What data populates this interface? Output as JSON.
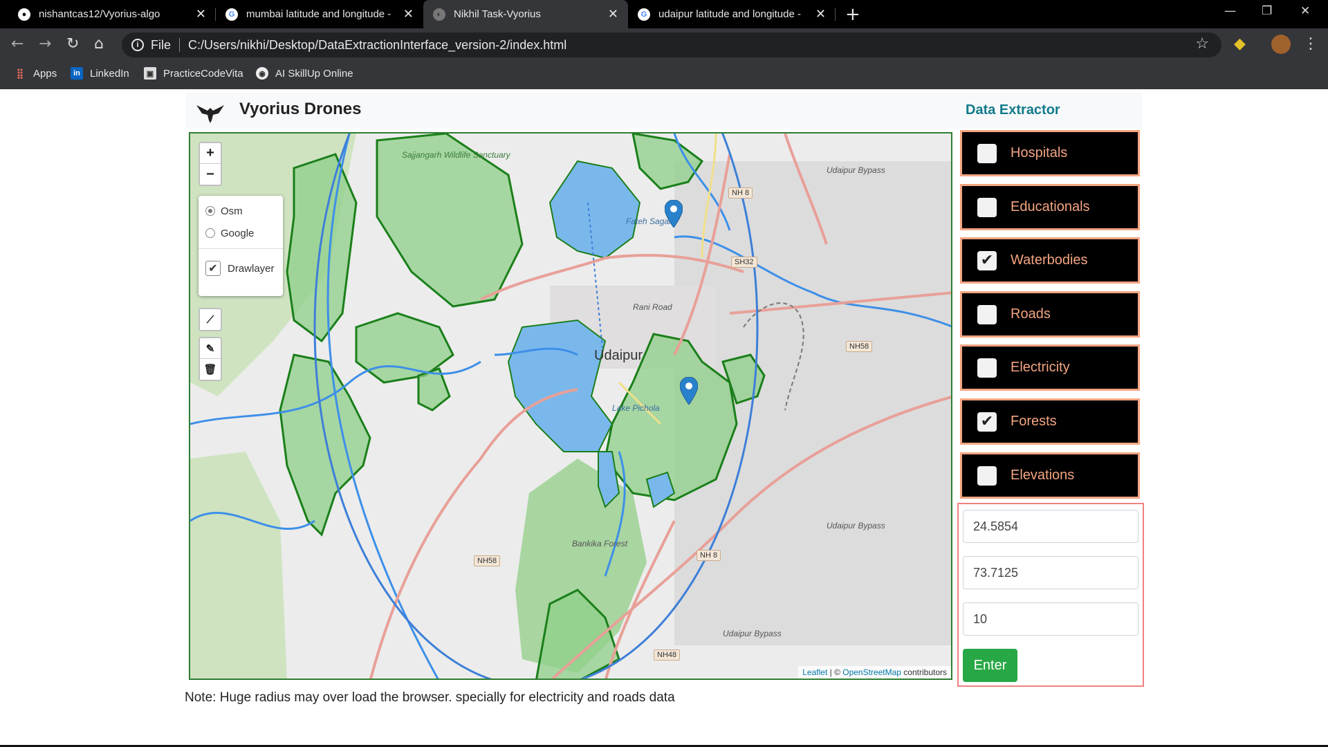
{
  "browser": {
    "tabs": [
      {
        "title": "nishantcas12/Vyorius-algo",
        "icon": "github-icon",
        "active": false
      },
      {
        "title": "mumbai latitude and longitude -",
        "icon": "google-icon",
        "active": false
      },
      {
        "title": "Nikhil Task-Vyorius",
        "icon": "globe-icon",
        "active": true
      },
      {
        "title": "udaipur latitude and longitude -",
        "icon": "google-icon",
        "active": false
      }
    ],
    "scheme_label": "File",
    "url": "C:/Users/nikhi/Desktop/DataExtractionInterface_version-2/index.html",
    "bookmarks": [
      {
        "label": "Apps",
        "icon": "apps-grid-icon"
      },
      {
        "label": "LinkedIn",
        "icon": "linkedin-icon"
      },
      {
        "label": "PracticeCodeVita",
        "icon": "codevita-icon"
      },
      {
        "label": "AI  SkillUp Online",
        "icon": "globe-icon"
      }
    ]
  },
  "header": {
    "brand": "Vyorius Drones",
    "extractor_title": "Data Extractor"
  },
  "map": {
    "zoom_in": "+",
    "zoom_out": "−",
    "layers": {
      "base": [
        {
          "label": "Osm",
          "selected": true
        },
        {
          "label": "Google",
          "selected": false
        }
      ],
      "overlay": {
        "label": "Drawlayer",
        "checked": true
      }
    },
    "labels": {
      "city": "Udaipur",
      "sanctuary": "Sajjangarh Wildlife Sanctuary",
      "lake_fateh": "Fateh Sagar",
      "lake_pichola": "Lake Pichola",
      "forest": "Bankika Forest",
      "rani_road": "Rani Road",
      "bypass_1": "Udaipur Bypass",
      "bypass_2": "Udaipur Bypass",
      "bypass_3": "Udaipur Bypass"
    },
    "shields": [
      "NH 8",
      "SH32",
      "NH58",
      "NH58",
      "NH 8",
      "NH48"
    ],
    "attribution": {
      "leaflet": "Leaflet",
      "sep": " | © ",
      "osm": "OpenStreetMap",
      "suffix": " contributors"
    }
  },
  "categories": [
    {
      "label": "Hospitals",
      "checked": false
    },
    {
      "label": "Educationals",
      "checked": false
    },
    {
      "label": "Waterbodies",
      "checked": true
    },
    {
      "label": "Roads",
      "checked": false
    },
    {
      "label": "Electricity",
      "checked": false
    },
    {
      "label": "Forests",
      "checked": true
    },
    {
      "label": "Elevations",
      "checked": false
    }
  ],
  "form": {
    "latitude": "24.5854",
    "longitude": "73.7125",
    "radius": "10",
    "submit": "Enter"
  },
  "note": "Note: Huge radius may over load the browser. specially for electricity and roads data",
  "colors": {
    "category_bg": "#000000",
    "category_accent": "#f4a582",
    "submit_bg": "#28a745",
    "heading": "#117a8b",
    "forest": "#8fcf8a",
    "water": "#7ab8ec"
  }
}
